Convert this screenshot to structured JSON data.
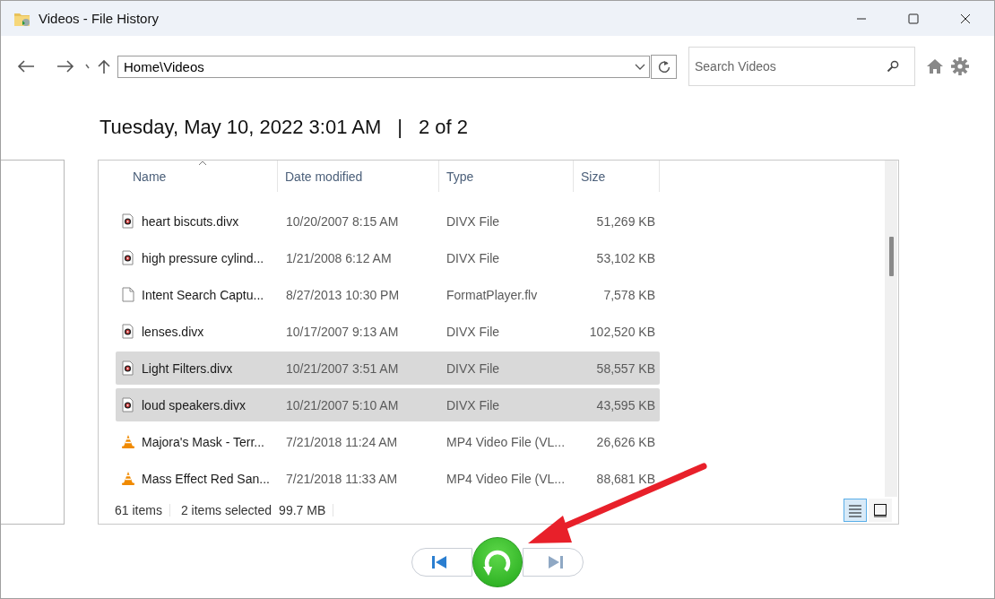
{
  "window": {
    "title": "Videos - File History"
  },
  "address": {
    "value": "Home\\Videos"
  },
  "search": {
    "placeholder": "Search Videos"
  },
  "snapshot": {
    "date": "Tuesday, May 10, 2022 3:01 AM",
    "separator": "|",
    "position": "2 of 2"
  },
  "table": {
    "columns": [
      "Name",
      "Date modified",
      "Type",
      "Size"
    ],
    "rows": [
      {
        "kind": "divx",
        "name": "heart biscuts.divx",
        "date": "10/20/2007 8:15 AM",
        "type": "DIVX File",
        "size": "51,269 KB",
        "selected": false
      },
      {
        "kind": "divx",
        "name": "high pressure cylind...",
        "date": "1/21/2008 6:12 AM",
        "type": "DIVX File",
        "size": "53,102 KB",
        "selected": false
      },
      {
        "kind": "blank",
        "name": "Intent Search Captu...",
        "date": "8/27/2013 10:30 PM",
        "type": "FormatPlayer.flv",
        "size": "7,578 KB",
        "selected": false
      },
      {
        "kind": "divx",
        "name": "lenses.divx",
        "date": "10/17/2007 9:13 AM",
        "type": "DIVX File",
        "size": "102,520 KB",
        "selected": false
      },
      {
        "kind": "divx",
        "name": "Light Filters.divx",
        "date": "10/21/2007 3:51 AM",
        "type": "DIVX File",
        "size": "58,557 KB",
        "selected": true
      },
      {
        "kind": "divx",
        "name": "loud speakers.divx",
        "date": "10/21/2007 5:10 AM",
        "type": "DIVX File",
        "size": "43,595 KB",
        "selected": true
      },
      {
        "kind": "vlc",
        "name": "Majora's Mask - Terr...",
        "date": "7/21/2018 11:24 AM",
        "type": "MP4 Video File (VL...",
        "size": "26,626 KB",
        "selected": false
      },
      {
        "kind": "vlc",
        "name": "Mass Effect Red San...",
        "date": "7/21/2018 11:33 AM",
        "type": "MP4 Video File (VL...",
        "size": "88,681 KB",
        "selected": false
      }
    ]
  },
  "status_bar": {
    "count": "61 items",
    "selection": "2 items selected",
    "size": "99.7 MB"
  },
  "view_buttons": [
    {
      "kind": "details",
      "selected": true
    },
    {
      "kind": "large",
      "selected": false
    }
  ],
  "playback": {
    "previous": {
      "disabled": false
    },
    "next": {
      "disabled": true
    }
  }
}
